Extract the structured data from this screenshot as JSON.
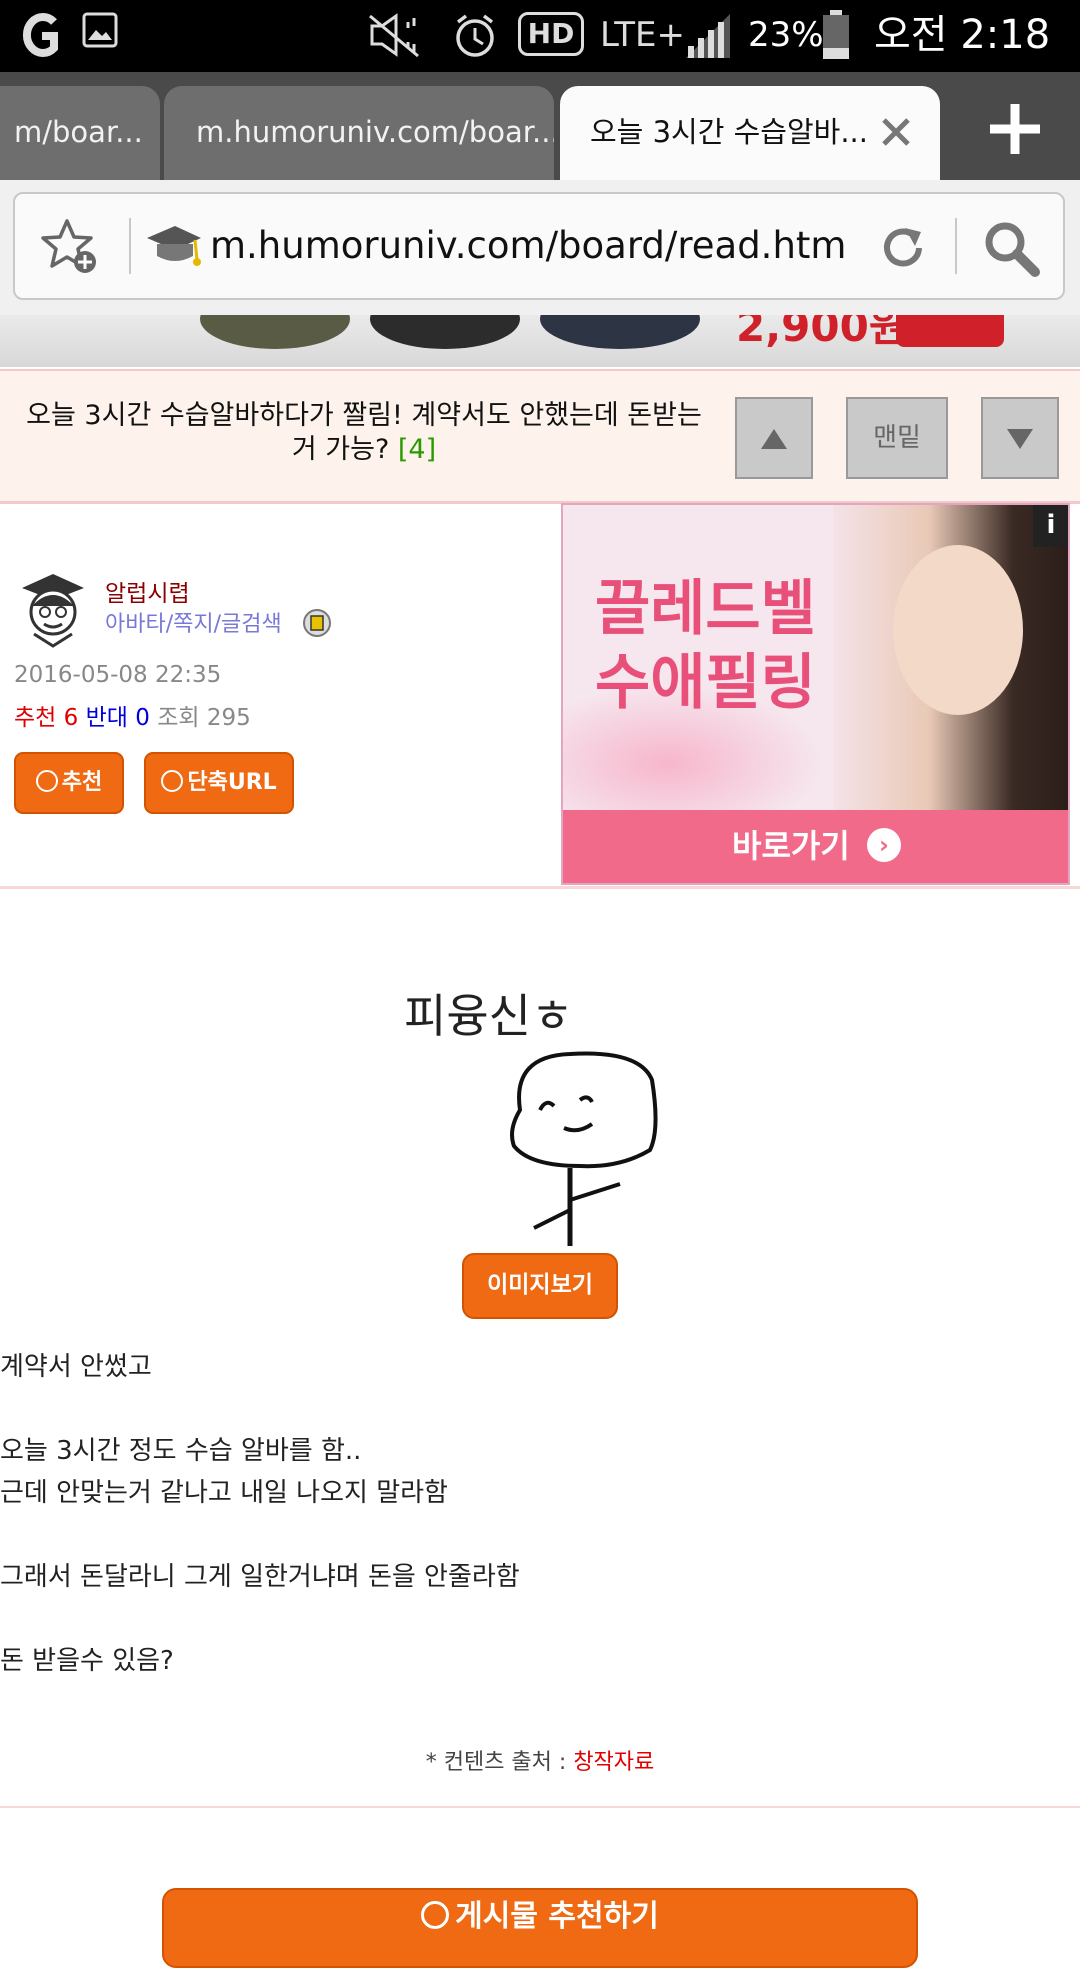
{
  "status_bar": {
    "battery": "23%",
    "time": "오전 2:18",
    "network": "LTE+",
    "hd": "HD"
  },
  "tabs": [
    {
      "label": "m/boar..."
    },
    {
      "label": "m.humoruniv.com/boar..."
    },
    {
      "label": "오늘 3시간 수습알바..."
    }
  ],
  "url": "m.humoruniv.com/board/read.html?t",
  "ad_strip": {
    "price": "2,900원"
  },
  "post": {
    "title": "오늘 3시간 수습알바하다가 짤림! 계약서도 안했는데 돈받는거 가능?",
    "comment_count": "[4]",
    "nav_bottom_label": "맨밑",
    "author": "알럽시렵",
    "author_links": "아바타/쪽지/글검색",
    "date": "2016-05-08 22:35",
    "stats": {
      "recommend_label": "추천",
      "recommend": "6",
      "oppose_label": "반대",
      "oppose": "0",
      "views_label": "조회",
      "views": "295"
    },
    "recommend_button": "추천",
    "short_url_button": "단축URL",
    "image_caption": "피융신ㅎ",
    "view_image_button": "이미지보기",
    "body": [
      "계약서 안썼고",
      "오늘 3시간 정도 수습 알바를 함..",
      "근데 안맞는거 같나고 내일 나오지 말라함",
      "그래서 돈달라니 그게 일한거냐며 돈을 안줄라함",
      "돈 받을수 있음?"
    ],
    "source_label": "* 컨텐츠 출처 :",
    "source_value": "창작자료",
    "recommend_post_button": "게시물 추천하기"
  },
  "ad": {
    "headline_1": "끌레드벨",
    "headline_2": "수애필링",
    "cta": "바로가기",
    "info": "i"
  },
  "colors": {
    "accent_orange": "#ef6a12",
    "recommend_red": "#e00000",
    "oppose_blue": "#0000dd",
    "count_green": "#2a9a00"
  }
}
